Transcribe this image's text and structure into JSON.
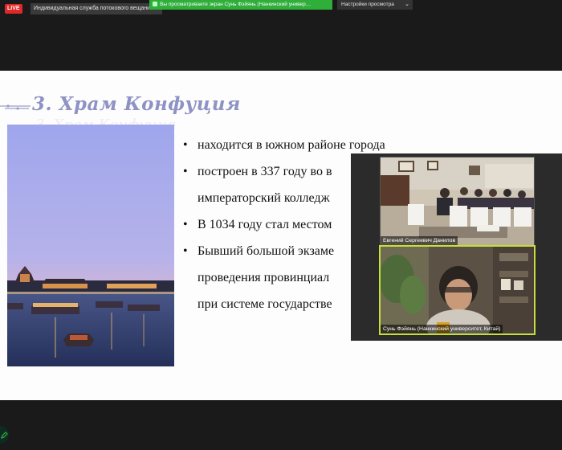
{
  "topbar": {
    "live_label": "LIVE",
    "service_label": "Индивидуальная служба потокового вещани",
    "share_banner": "Вы просматриваете экран Сунь Фэйянь (Нанкинский универ…",
    "view_settings_label": "Настройки просмотра",
    "colors": {
      "share_green": "#2fae3a",
      "live_red": "#e02828"
    }
  },
  "slide": {
    "title": "3. Храм Конфуция",
    "bullets": [
      {
        "marker": "•",
        "text": " находится в южном районе города"
      },
      {
        "marker": "•",
        "text": "построен в 337 году во в"
      },
      {
        "marker": "",
        "text": "императорский колледж"
      },
      {
        "marker": "•",
        "text": "В 1034 году стал местом"
      },
      {
        "marker": "•",
        "text": "Бывший большой экзаме"
      },
      {
        "marker": "",
        "text": "проведения провинциал"
      },
      {
        "marker": "",
        "text": "при системе государстве"
      }
    ],
    "colors": {
      "title": "#8e92c4"
    }
  },
  "participants": [
    {
      "name": "Евгений Сергеевич Данилов"
    },
    {
      "name": "Сунь Фэйянь (Нанкинский университет, Китай)",
      "active_speaker": true
    }
  ]
}
